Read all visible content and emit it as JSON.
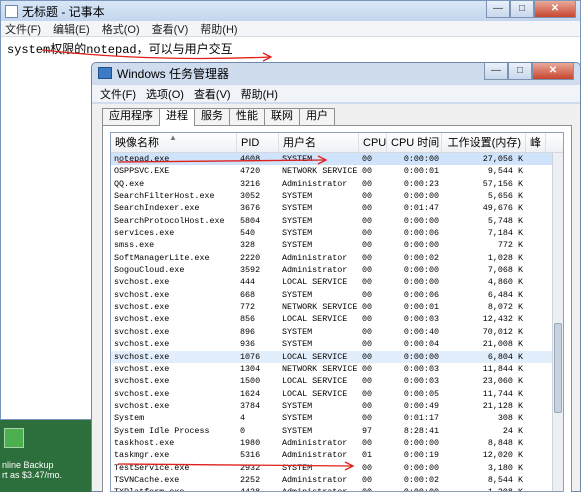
{
  "notepad": {
    "title": "无标题 - 记事本",
    "menu": [
      "文件(F)",
      "编辑(E)",
      "格式(O)",
      "查看(V)",
      "帮助(H)"
    ],
    "content": "system权限的notepad，可以与用户交互"
  },
  "desktop": {
    "caption": "nline Backup\nrt as $3.47/mo."
  },
  "taskmgr": {
    "title": "Windows 任务管理器",
    "menu": [
      "文件(F)",
      "选项(O)",
      "查看(V)",
      "帮助(H)"
    ],
    "tabs": [
      "应用程序",
      "进程",
      "服务",
      "性能",
      "联网",
      "用户"
    ],
    "active_tab": 1,
    "columns": [
      "映像名称",
      "PID",
      "用户名",
      "CPU",
      "CPU 时间",
      "工作设置(内存)",
      "峰"
    ],
    "rows": [
      [
        "notepad.exe",
        "4608",
        "SYSTEM",
        "00",
        "0:00:00",
        "27,056 K"
      ],
      [
        "OSPPSVC.EXE",
        "4720",
        "NETWORK SERVICE",
        "00",
        "0:00:01",
        "9,544 K"
      ],
      [
        "QQ.exe",
        "3216",
        "Administrator",
        "00",
        "0:00:23",
        "57,156 K"
      ],
      [
        "SearchFilterHost.exe",
        "3052",
        "SYSTEM",
        "00",
        "0:00:00",
        "5,656 K"
      ],
      [
        "SearchIndexer.exe",
        "3676",
        "SYSTEM",
        "00",
        "0:01:47",
        "49,676 K"
      ],
      [
        "SearchProtocolHost.exe",
        "5804",
        "SYSTEM",
        "00",
        "0:00:00",
        "5,748 K"
      ],
      [
        "services.exe",
        "540",
        "SYSTEM",
        "00",
        "0:00:06",
        "7,184 K"
      ],
      [
        "smss.exe",
        "328",
        "SYSTEM",
        "00",
        "0:00:00",
        "772 K"
      ],
      [
        "SoftManagerLite.exe",
        "2220",
        "Administrator",
        "00",
        "0:00:02",
        "1,028 K"
      ],
      [
        "SogouCloud.exe",
        "3592",
        "Administrator",
        "00",
        "0:00:00",
        "7,068 K"
      ],
      [
        "svchost.exe",
        "444",
        "LOCAL SERVICE",
        "00",
        "0:00:00",
        "4,860 K"
      ],
      [
        "svchost.exe",
        "668",
        "SYSTEM",
        "00",
        "0:00:06",
        "6,484 K"
      ],
      [
        "svchost.exe",
        "772",
        "NETWORK SERVICE",
        "00",
        "0:00:01",
        "8,072 K"
      ],
      [
        "svchost.exe",
        "856",
        "LOCAL SERVICE",
        "00",
        "0:00:03",
        "12,432 K"
      ],
      [
        "svchost.exe",
        "896",
        "SYSTEM",
        "00",
        "0:00:40",
        "70,012 K"
      ],
      [
        "svchost.exe",
        "936",
        "SYSTEM",
        "00",
        "0:00:04",
        "21,008 K"
      ],
      [
        "svchost.exe",
        "1076",
        "LOCAL SERVICE",
        "00",
        "0:00:00",
        "6,804 K"
      ],
      [
        "svchost.exe",
        "1304",
        "NETWORK SERVICE",
        "00",
        "0:00:03",
        "11,844 K"
      ],
      [
        "svchost.exe",
        "1500",
        "LOCAL SERVICE",
        "00",
        "0:00:03",
        "23,060 K"
      ],
      [
        "svchost.exe",
        "1624",
        "LOCAL SERVICE",
        "00",
        "0:00:05",
        "11,744 K"
      ],
      [
        "svchost.exe",
        "3784",
        "SYSTEM",
        "00",
        "0:00:49",
        "21,128 K"
      ],
      [
        "System",
        "4",
        "SYSTEM",
        "00",
        "0:01:17",
        "308 K"
      ],
      [
        "System Idle Process",
        "0",
        "SYSTEM",
        "97",
        "8:28:41",
        "24 K"
      ],
      [
        "taskhost.exe",
        "1980",
        "Administrator",
        "00",
        "0:00:00",
        "8,848 K"
      ],
      [
        "taskmgr.exe",
        "5316",
        "Administrator",
        "01",
        "0:00:19",
        "12,020 K"
      ],
      [
        "TestService.exe",
        "2932",
        "SYSTEM",
        "00",
        "0:00:00",
        "3,180 K"
      ],
      [
        "TSVNCache.exe",
        "2252",
        "Administrator",
        "00",
        "0:00:02",
        "8,544 K"
      ],
      [
        "TXPlatform.exe",
        "4428",
        "Administrator",
        "00",
        "0:00:00",
        "1,308 K"
      ]
    ],
    "selected_row": 0,
    "highlight_row": 16
  },
  "annotation_color": "#e0201a"
}
